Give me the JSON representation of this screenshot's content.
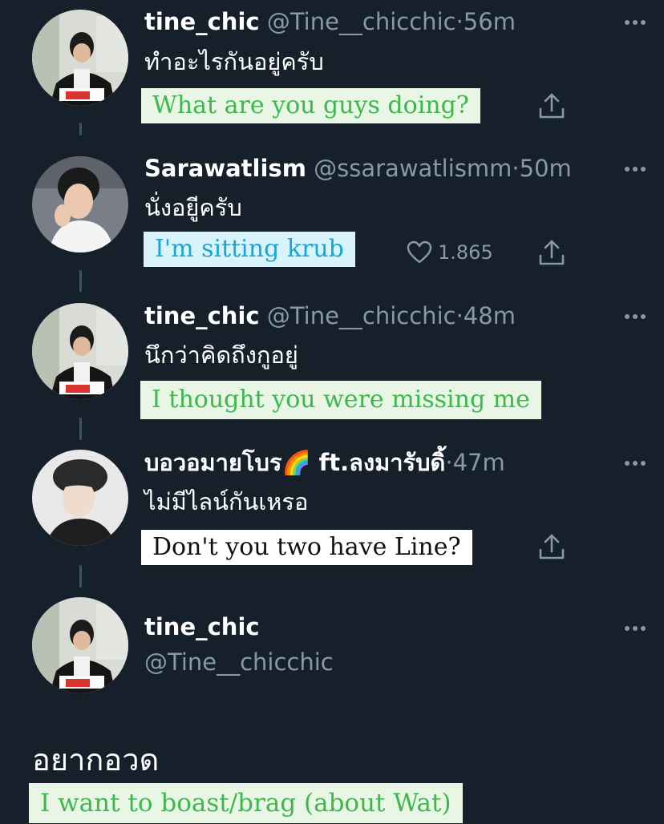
{
  "colors": {
    "background": "#15202b",
    "muted_text": "#8899a6",
    "thread_line": "#3d5466",
    "caption_green_bg": "#e9f6e6",
    "caption_green_text": "#3db84c",
    "caption_blue_bg": "#d9f3fb",
    "caption_blue_text": "#17a6d6"
  },
  "tweets": [
    {
      "name": "tine_chic",
      "handle": "@Tine__chicchic",
      "separator": "·",
      "time": "56m",
      "text": "ทำอะไรกันอยู่ครับ",
      "caption": "What are you guys doing?",
      "icons": [
        "more-icon",
        "share-icon"
      ]
    },
    {
      "name": "Sarawatlism",
      "handle": "@ssarawatlismm",
      "separator": "·",
      "time": "50m",
      "text": "นั่งอยูีครับ",
      "caption": "I'm sitting krub",
      "likes": "1.865",
      "icons": [
        "more-icon",
        "heart-icon",
        "share-icon"
      ]
    },
    {
      "name": "tine_chic",
      "handle": "@Tine__chicchic",
      "separator": "·",
      "time": "48m",
      "text": "นึกว่าคิดถึงกูอยู่",
      "caption": "I thought you were missing me",
      "icons": [
        "more-icon"
      ]
    },
    {
      "name": "บอวอมายโบร🌈 ft.ลงมารับดิ้",
      "separator": "·",
      "time": "47m",
      "text": "ไม่มีไลน์กันเหรอ",
      "caption": "Don't you two have Line?",
      "icons": [
        "more-icon",
        "share-icon"
      ]
    }
  ],
  "main_tweet": {
    "name": "tine_chic",
    "handle": "@Tine__chicchic",
    "text": "อยากอวด",
    "caption": "I want to boast/brag (about Wat)",
    "icons": [
      "more-icon"
    ]
  }
}
